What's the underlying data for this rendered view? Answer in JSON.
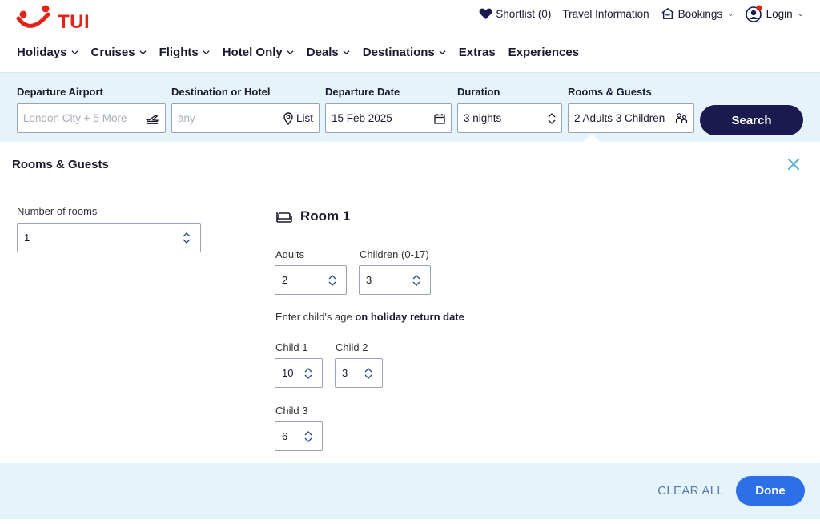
{
  "brand": {
    "name": "TUI",
    "color": "#e2231a"
  },
  "util_nav": {
    "shortlist": "Shortlist (0)",
    "travel_info": "Travel Information",
    "bookings": "Bookings",
    "login": "Login"
  },
  "main_nav": [
    {
      "label": "Holidays",
      "has_dropdown": true
    },
    {
      "label": "Cruises",
      "has_dropdown": true
    },
    {
      "label": "Flights",
      "has_dropdown": true
    },
    {
      "label": "Hotel Only",
      "has_dropdown": true
    },
    {
      "label": "Deals",
      "has_dropdown": true
    },
    {
      "label": "Destinations",
      "has_dropdown": true
    },
    {
      "label": "Extras",
      "has_dropdown": false
    },
    {
      "label": "Experiences",
      "has_dropdown": false
    }
  ],
  "search": {
    "departure_label": "Departure Airport",
    "departure_placeholder": "London City + 5 More",
    "destination_label": "Destination or Hotel",
    "destination_placeholder": "any",
    "list_label": "List",
    "date_label": "Departure Date",
    "date_value": "15 Feb 2025",
    "duration_label": "Duration",
    "duration_value": "3 nights",
    "rooms_label": "Rooms & Guests",
    "rooms_value": "2 Adults 3 Children",
    "search_button": "Search"
  },
  "panel": {
    "title": "Rooms & Guests",
    "rooms_label": "Number of rooms",
    "rooms_value": "1",
    "room_title": "Room 1",
    "adults_label": "Adults",
    "adults_value": "2",
    "children_label": "Children (0-17)",
    "children_value": "3",
    "age_note_prefix": "Enter child's age",
    "age_note_bold": "on holiday return date",
    "children": [
      {
        "label": "Child 1",
        "age": "10"
      },
      {
        "label": "Child 2",
        "age": "3"
      },
      {
        "label": "Child 3",
        "age": "6"
      }
    ]
  },
  "footer": {
    "clear_all": "CLEAR ALL",
    "done": "Done"
  },
  "colors": {
    "navy": "#1a1a4e",
    "light_blue": "#e5f4fb",
    "done_blue": "#2d6fe8",
    "close_blue": "#5ab4d9"
  }
}
